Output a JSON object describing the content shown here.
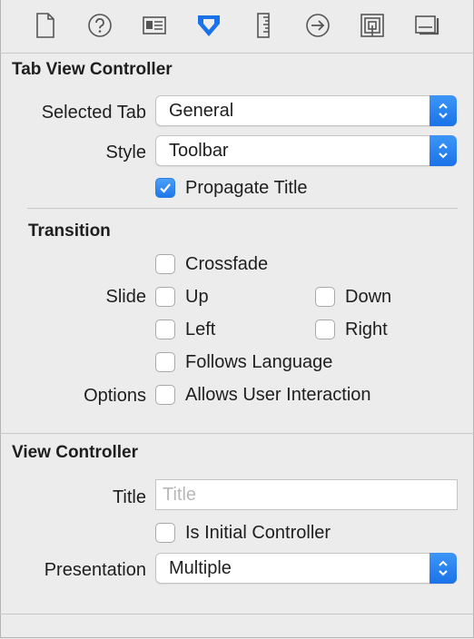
{
  "toolbar": {
    "icons": [
      {
        "name": "file-icon"
      },
      {
        "name": "help-icon"
      },
      {
        "name": "identity-icon"
      },
      {
        "name": "attributes-icon",
        "selected": true
      },
      {
        "name": "size-icon"
      },
      {
        "name": "connections-icon"
      },
      {
        "name": "bindings-icon"
      },
      {
        "name": "effects-icon"
      }
    ],
    "accent": "#1a72e8"
  },
  "tab_view_controller": {
    "section_title": "Tab View Controller",
    "selected_tab_label": "Selected Tab",
    "selected_tab_value": "General",
    "style_label": "Style",
    "style_value": "Toolbar",
    "propagate_title_label": "Propagate Title",
    "propagate_title_checked": true
  },
  "transition": {
    "title": "Transition",
    "crossfade_label": "Crossfade",
    "slide_label": "Slide",
    "up_label": "Up",
    "down_label": "Down",
    "left_label": "Left",
    "right_label": "Right",
    "follows_language_label": "Follows Language",
    "options_label": "Options",
    "allows_user_interaction_label": "Allows User Interaction"
  },
  "view_controller": {
    "section_title": "View Controller",
    "title_label": "Title",
    "title_value": "",
    "title_placeholder": "Title",
    "is_initial_label": "Is Initial Controller",
    "presentation_label": "Presentation",
    "presentation_value": "Multiple"
  }
}
